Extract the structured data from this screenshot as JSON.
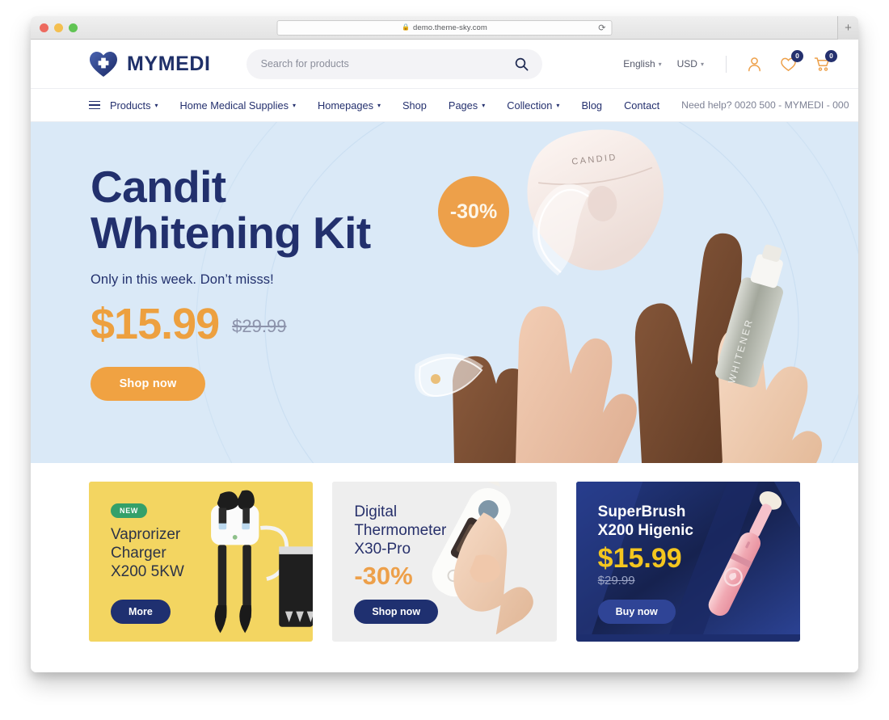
{
  "browser": {
    "url": "demo.theme-sky.com",
    "lock_icon": "lock-icon",
    "reload_icon": "reload-icon",
    "newtab_label": "+",
    "traffic_lights": [
      "close",
      "minimize",
      "zoom"
    ]
  },
  "header": {
    "brand": "MYMEDI",
    "logo_icon": "heart-cross-logo-icon",
    "search": {
      "placeholder": "Search for products",
      "value": "",
      "icon": "search-icon"
    },
    "language": {
      "label": "English",
      "caret": "⌄"
    },
    "currency": {
      "label": "USD",
      "caret": "⌄"
    },
    "account_icon": "user-icon",
    "wishlist": {
      "icon": "heart-icon",
      "count": "0"
    },
    "cart": {
      "icon": "cart-icon",
      "count": "0"
    }
  },
  "nav": {
    "menu_icon": "hamburger-menu-icon",
    "items": [
      {
        "label": "Products",
        "caret": "⌄"
      },
      {
        "label": "Home Medical Supplies",
        "caret": "⌄"
      },
      {
        "label": "Homepages",
        "caret": "⌄"
      },
      {
        "label": "Shop",
        "caret": ""
      },
      {
        "label": "Pages",
        "caret": "⌄"
      },
      {
        "label": "Collection",
        "caret": "⌄"
      },
      {
        "label": "Blog",
        "caret": ""
      },
      {
        "label": "Contact",
        "caret": ""
      }
    ],
    "need_help": "Need help? 0020 500 - MYMEDI - 000"
  },
  "hero": {
    "title_line1": "Candit",
    "title_line2": "Whitening Kit",
    "subtitle": "Only in this week. Don’t misss!",
    "price_new": "$15.99",
    "price_old": "$29.99",
    "cta": "Shop now",
    "sale_badge": "-30%",
    "product_label": "CANDID",
    "bottle_label": "WHITENER",
    "bg_color": "#dae9f7",
    "accent_color": "#f0a242",
    "navy_color": "#22306d"
  },
  "promos": [
    {
      "badge": "NEW",
      "title": "Vaprorizer\nCharger\nX200 5KW",
      "discount": "",
      "price_new": "",
      "price_old": "",
      "cta": "More",
      "bg_color": "#f3d561"
    },
    {
      "badge": "",
      "title": "Digital\nThermometer\nX30-Pro",
      "discount": "-30%",
      "price_new": "",
      "price_old": "",
      "cta": "Shop now",
      "bg_color": "#eeeeee"
    },
    {
      "badge": "",
      "title": "SuperBrush\nX200 Higenic",
      "discount": "",
      "price_new": "$15.99",
      "price_old": "$29.99",
      "cta": "Buy now",
      "bg_color": "#1d2e6e"
    }
  ]
}
